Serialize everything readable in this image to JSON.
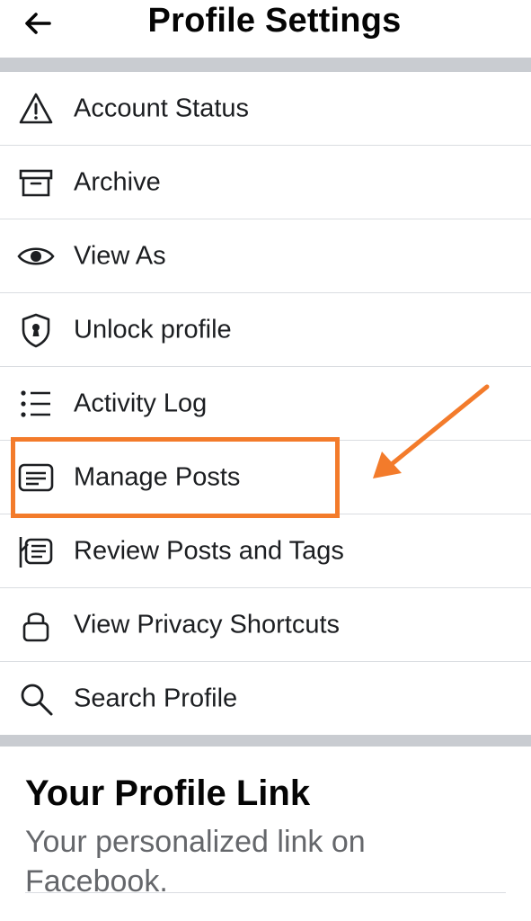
{
  "header": {
    "title": "Profile Settings",
    "back_icon": "back-arrow-icon"
  },
  "menu": {
    "items": [
      {
        "label": "Account Status",
        "icon": "warning-triangle-icon"
      },
      {
        "label": "Archive",
        "icon": "archive-box-icon"
      },
      {
        "label": "View As",
        "icon": "eye-icon"
      },
      {
        "label": "Unlock profile",
        "icon": "shield-keyhole-icon"
      },
      {
        "label": "Activity Log",
        "icon": "list-icon"
      },
      {
        "label": "Manage Posts",
        "icon": "posts-card-icon"
      },
      {
        "label": "Review Posts and Tags",
        "icon": "tagged-posts-icon"
      },
      {
        "label": "View Privacy Shortcuts",
        "icon": "lock-icon"
      },
      {
        "label": "Search Profile",
        "icon": "search-icon"
      }
    ]
  },
  "profile_link": {
    "title": "Your Profile Link",
    "description": "Your personalized link on Facebook."
  },
  "colors": {
    "highlight": "#f37b2b",
    "section_band": "#c9ccd1",
    "secondary_text": "#65676b"
  }
}
